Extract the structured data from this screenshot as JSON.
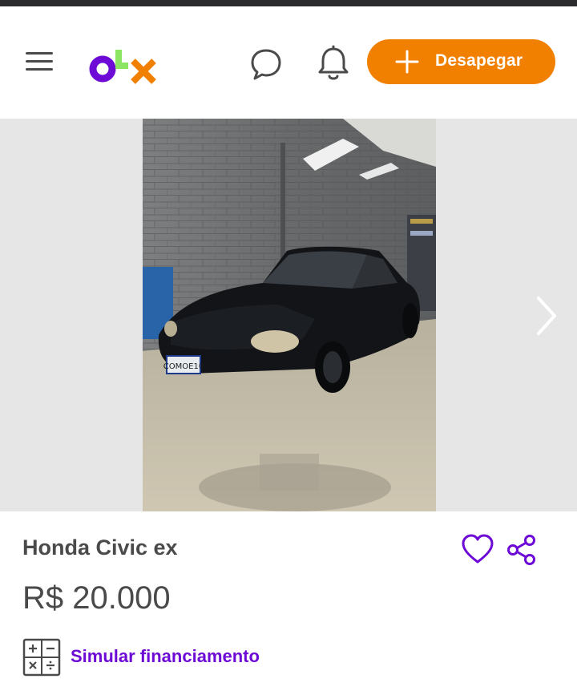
{
  "header": {
    "logo_letters": [
      "o",
      "l",
      "x"
    ],
    "cta_label": "Desapegar",
    "icons": {
      "menu": "hamburger-menu-icon",
      "chat": "chat-bubble-icon",
      "notifications": "bell-icon",
      "cta": "plus-icon"
    }
  },
  "gallery": {
    "photo_subject": "black sedan in garage",
    "plate_text": "COMOE10",
    "next_icon": "chevron-right-icon"
  },
  "listing": {
    "title": "Honda Civic ex",
    "price": "R$ 20.000",
    "favorite_icon": "heart-icon",
    "share_icon": "share-icon"
  },
  "financing": {
    "label": "Simular financiamento",
    "icon": "calculator-icon"
  },
  "colors": {
    "brand_purple": "#6e0ad6",
    "brand_orange": "#f28000",
    "brand_green": "#8ce563",
    "text": "#4a4a4a"
  }
}
